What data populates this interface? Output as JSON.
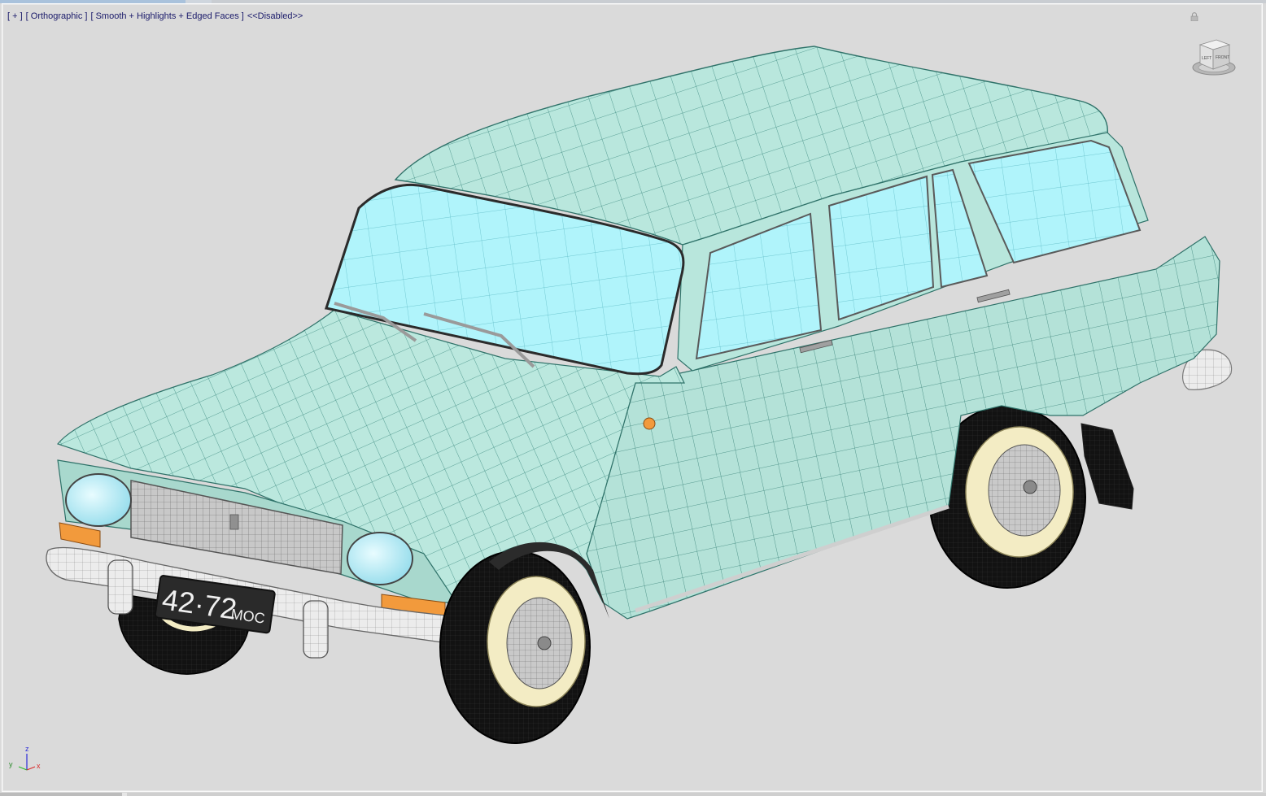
{
  "viewport": {
    "menu_plus": "[ + ]",
    "view_name": "[ Orthographic ]",
    "shading": "[ Smooth + Highlights + Edged Faces ]",
    "extra": "<<Disabled>>"
  },
  "viewcube": {
    "face_left": "LEFT",
    "face_front": "FRONT"
  },
  "axis": {
    "z": "z",
    "y": "y",
    "x": "x"
  },
  "model": {
    "license_plate": "42-72 МОС",
    "plate_digits": "42·72",
    "plate_region": "МОС"
  },
  "icons": [
    "lock-icon",
    "viewcube-icon",
    "axis-tripod-icon"
  ],
  "colors": {
    "background": "#dadada",
    "body_paint": "#b8e6dc",
    "wire": "#3a8c82",
    "glass": "#aef3fb",
    "chrome": "#e4e4e4",
    "tire": "#111111",
    "hubcap_rim": "#f3ecc4",
    "indicator": "#f29a3c",
    "label_text": "#1a1a6a"
  }
}
